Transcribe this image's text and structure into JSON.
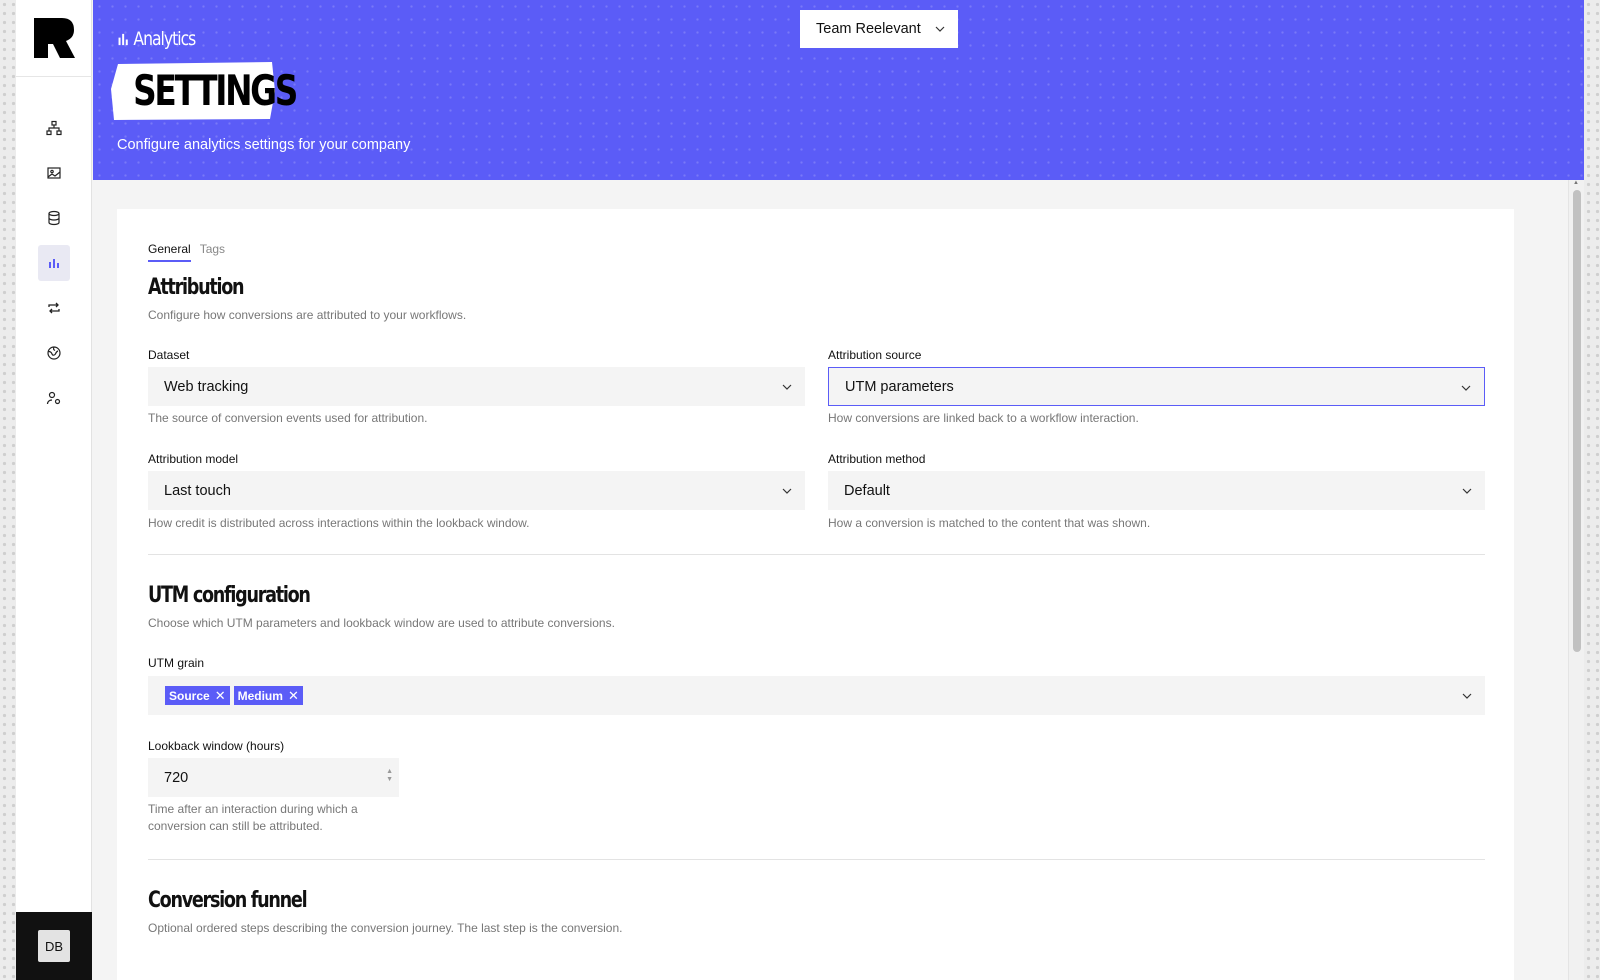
{
  "header": {
    "section": "Analytics",
    "title": "SETTINGS",
    "subtitle": "Configure analytics settings for your company",
    "team_select": "Team Reelevant",
    "color": "#5b5cf7"
  },
  "sidebar": {
    "items": [
      {
        "icon": "sitemap-icon"
      },
      {
        "icon": "image-gallery-icon"
      },
      {
        "icon": "database-icon"
      },
      {
        "icon": "bar-chart-icon",
        "active": true
      },
      {
        "icon": "repeat-icon"
      },
      {
        "icon": "globe-icon"
      },
      {
        "icon": "user-settings-icon"
      }
    ],
    "user_initials": "DB"
  },
  "tabs": [
    "General",
    "Tags"
  ],
  "attribution": {
    "title": "Attribution",
    "description": "Configure how conversions are attributed to your workflows.",
    "dataset": {
      "label": "Dataset",
      "value": "Web tracking",
      "help": "The source of conversion events used for attribution."
    },
    "source": {
      "label": "Attribution source",
      "value": "UTM parameters",
      "help": "How conversions are linked back to a workflow interaction."
    },
    "model": {
      "label": "Attribution model",
      "value": "Last touch",
      "help": "How credit is distributed across interactions within the lookback window."
    },
    "method": {
      "label": "Attribution method",
      "value": "Default",
      "help": "How a conversion is matched to the content that was shown."
    }
  },
  "utm": {
    "title": "UTM configuration",
    "description": "Choose which UTM parameters and lookback window are used to attribute conversions.",
    "grain_label": "UTM grain",
    "grain_chips": [
      "Source",
      "Medium"
    ],
    "lookback_label": "Lookback window (hours)",
    "lookback_value": "720",
    "lookback_help_1": "Time after an interaction during which a",
    "lookback_help_2": "conversion can still be attributed."
  },
  "funnel": {
    "title": "Conversion funnel",
    "description": "Optional ordered steps describing the conversion journey. The last step is the conversion."
  }
}
